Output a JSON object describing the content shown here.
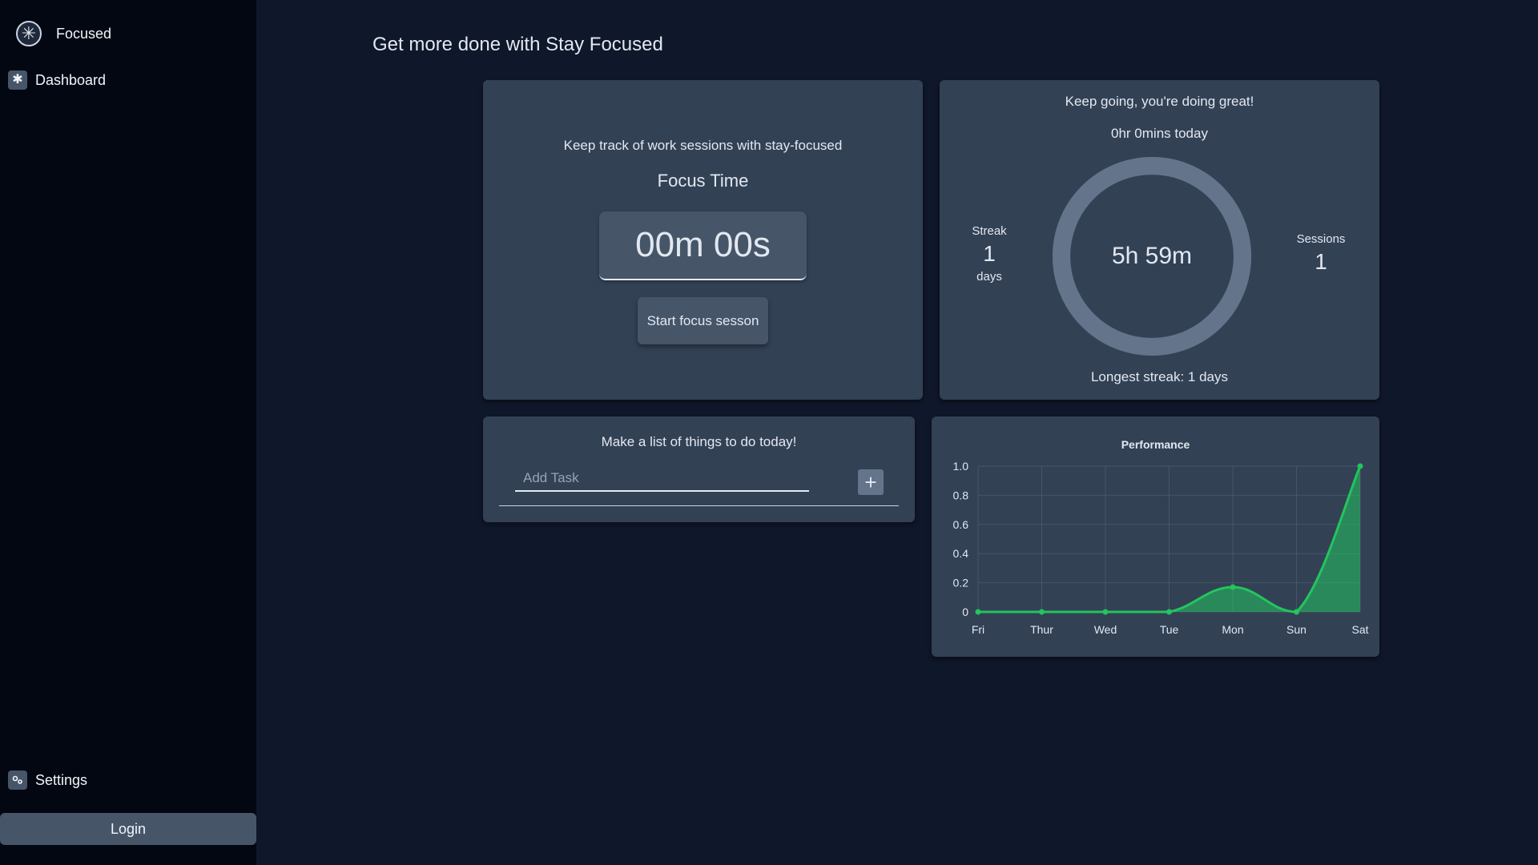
{
  "sidebar": {
    "brand": {
      "label": "Focused",
      "icon": "snowflake-icon"
    },
    "nav": [
      {
        "label": "Dashboard",
        "icon": "snowflake-icon"
      }
    ],
    "settings": {
      "label": "Settings",
      "icon": "gears-icon"
    },
    "login_label": "Login"
  },
  "header": {
    "title": "Get more done with Stay Focused"
  },
  "timer_card": {
    "subtitle": "Keep track of work sessions with stay-focused",
    "heading": "Focus Time",
    "time": "00m 00s",
    "start_label": "Start focus sesson"
  },
  "stats_card": {
    "encouragement": "Keep going, you're doing great!",
    "today": "0hr 0mins today",
    "ring_value": "5h 59m",
    "ring_fill": 1.0,
    "streak": {
      "label": "Streak",
      "value": "1",
      "unit": "days"
    },
    "sessions": {
      "label": "Sessions",
      "value": "1"
    },
    "longest_streak": "Longest streak: 1 days"
  },
  "todo_card": {
    "prompt": "Make a list of things to do today!",
    "placeholder": "Add Task",
    "add_icon": "plus-icon"
  },
  "colors": {
    "accent_green": "#22c55e",
    "card_bg": "#334155",
    "page_bg": "#0f172a",
    "sidebar_bg": "#030712",
    "ring": "#64748b"
  },
  "chart_data": {
    "type": "area",
    "title": "Performance",
    "categories": [
      "Fri",
      "Thur",
      "Wed",
      "Tue",
      "Mon",
      "Sun",
      "Sat"
    ],
    "series": [
      {
        "values": [
          0,
          0,
          0,
          0,
          0.17,
          0,
          1.0
        ]
      }
    ],
    "ylim": [
      0,
      1.0
    ],
    "yticks": [
      "0",
      "0.2",
      "0.4",
      "0.6",
      "0.8",
      "1.0"
    ],
    "grid": true,
    "legend": "none"
  }
}
